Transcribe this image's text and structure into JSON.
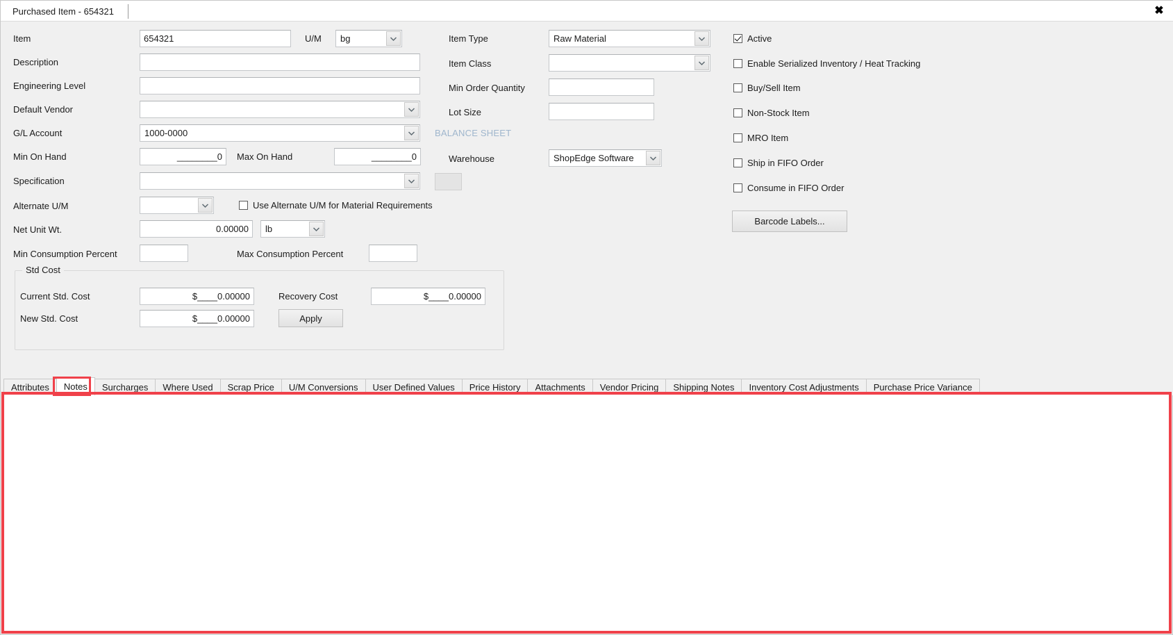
{
  "window": {
    "tab_title": "Purchased Item - 654321",
    "close_label": "✖"
  },
  "colors": {
    "background": "#f0f0f0",
    "field_bg": "#ffffff",
    "highlight_red": "#f0414a",
    "balance_sheet_text": "#9fb6cd",
    "text": "#1b1b1b"
  },
  "form": {
    "left": {
      "item": {
        "label": "Item",
        "value": "654321"
      },
      "um": {
        "label": "U/M",
        "value": "bg"
      },
      "description": {
        "label": "Description",
        "value": ""
      },
      "engineering_level": {
        "label": "Engineering Level",
        "value": ""
      },
      "default_vendor": {
        "label": "Default Vendor",
        "value": ""
      },
      "gl_account": {
        "label": "G/L Account",
        "value": "1000-0000"
      },
      "min_on_hand": {
        "label": "Min On Hand",
        "value": "________0"
      },
      "max_on_hand": {
        "label": "Max On Hand",
        "value": "________0"
      },
      "specification": {
        "label": "Specification",
        "value": ""
      },
      "alternate_um": {
        "label": "Alternate U/M",
        "value": ""
      },
      "use_alternate_um": {
        "label": "Use Alternate U/M for Material Requirements",
        "checked": false
      },
      "net_unit_wt": {
        "label": "Net Unit Wt.",
        "value": "0.00000",
        "uom": "lb"
      },
      "min_consumption_percent": {
        "label": "Min Consumption Percent",
        "value": ""
      },
      "max_consumption_percent": {
        "label": "Max Consumption Percent",
        "value": ""
      }
    },
    "std_cost": {
      "title": "Std Cost",
      "current_std_cost": {
        "label": "Current Std. Cost",
        "value": "$____0.00000"
      },
      "recovery_cost": {
        "label": "Recovery Cost",
        "value": "$____0.00000"
      },
      "new_std_cost": {
        "label": "New Std. Cost",
        "value": "$____0.00000"
      },
      "apply_button": "Apply"
    },
    "middle": {
      "item_type": {
        "label": "Item Type",
        "value": "Raw Material"
      },
      "item_class": {
        "label": "Item Class",
        "value": ""
      },
      "min_order_quantity": {
        "label": "Min Order Quantity",
        "value": ""
      },
      "lot_size": {
        "label": "Lot Size",
        "value": ""
      },
      "balance_sheet_note": "BALANCE SHEET",
      "warehouse": {
        "label": "Warehouse",
        "value": "ShopEdge Software"
      }
    },
    "right": {
      "checkboxes": [
        {
          "label": "Active",
          "checked": true
        },
        {
          "label": "Enable Serialized Inventory / Heat Tracking",
          "checked": false
        },
        {
          "label": "Buy/Sell Item",
          "checked": false
        },
        {
          "label": "Non-Stock Item",
          "checked": false
        },
        {
          "label": "MRO Item",
          "checked": false
        },
        {
          "label": "Ship in FIFO Order",
          "checked": false
        },
        {
          "label": "Consume in FIFO Order",
          "checked": false
        }
      ],
      "barcode_button": "Barcode Labels..."
    }
  },
  "tabs": {
    "selected": "Notes",
    "items": [
      {
        "label": "Attributes"
      },
      {
        "label": "Notes"
      },
      {
        "label": "Surcharges"
      },
      {
        "label": "Where Used"
      },
      {
        "label": "Scrap Price"
      },
      {
        "label": "U/M Conversions"
      },
      {
        "label": "User Defined Values"
      },
      {
        "label": "Price History"
      },
      {
        "label": "Attachments"
      },
      {
        "label": "Vendor Pricing"
      },
      {
        "label": "Shipping Notes"
      },
      {
        "label": "Inventory Cost Adjustments"
      },
      {
        "label": "Purchase Price Variance"
      }
    ]
  },
  "notes_pane": {
    "content": ""
  }
}
